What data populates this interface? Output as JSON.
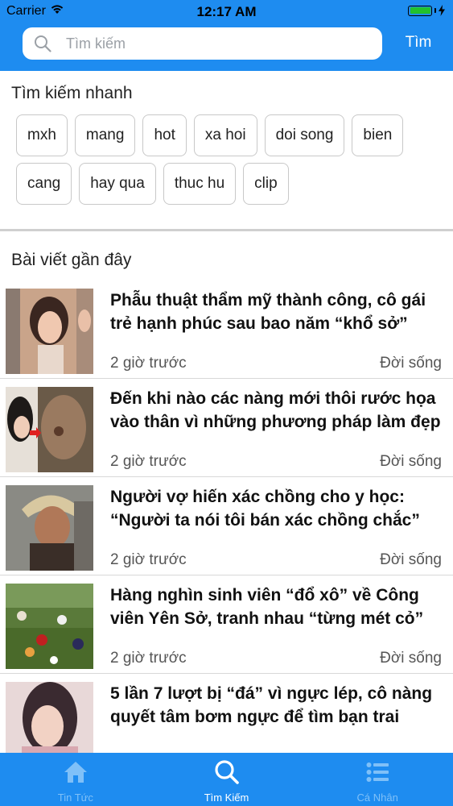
{
  "status_bar": {
    "carrier": "Carrier",
    "time": "12:17 AM"
  },
  "search": {
    "placeholder": "Tìm kiếm",
    "value": "",
    "button_label": "Tìm"
  },
  "quick_search": {
    "title": "Tìm kiếm nhanh",
    "tags": [
      "mxh",
      "mang",
      "hot",
      "xa hoi",
      "doi song",
      "bien",
      "cang",
      "hay qua",
      "thuc hu",
      "clip"
    ]
  },
  "recent": {
    "title": "Bài viết gần đây",
    "articles": [
      {
        "title": "Phẫu thuật thẩm mỹ thành công, cô gái trẻ hạnh phúc sau bao năm “khổ sở”",
        "time": "2 giờ trước",
        "category": "Đời sống"
      },
      {
        "title": "Đến khi nào các nàng mới thôi rước họa vào thân vì những phương pháp làm đẹp",
        "time": "2 giờ trước",
        "category": "Đời sống"
      },
      {
        "title": "Người vợ hiến xác chồng cho y học: “Người ta nói tôi bán xác chồng chắc”",
        "time": "2 giờ trước",
        "category": "Đời sống"
      },
      {
        "title": "Hàng nghìn sinh viên “đổ xô” về Công viên Yên Sở, tranh nhau “từng mét cỏ”",
        "time": "2 giờ trước",
        "category": "Đời sống"
      },
      {
        "title": "5 lần 7 lượt bị “đá” vì ngực lép, cô nàng quyết tâm bơm ngực để tìm bạn trai",
        "time": "",
        "category": ""
      }
    ]
  },
  "tabbar": {
    "tabs": [
      {
        "label": "Tin Tức",
        "icon": "home-icon",
        "active": false
      },
      {
        "label": "Tìm Kiếm",
        "icon": "search-icon",
        "active": true
      },
      {
        "label": "Cá Nhân",
        "icon": "list-icon",
        "active": false
      }
    ]
  },
  "colors": {
    "primary": "#1e8cf0",
    "tab_inactive": "#7fc0f8",
    "battery": "#22c12c"
  }
}
